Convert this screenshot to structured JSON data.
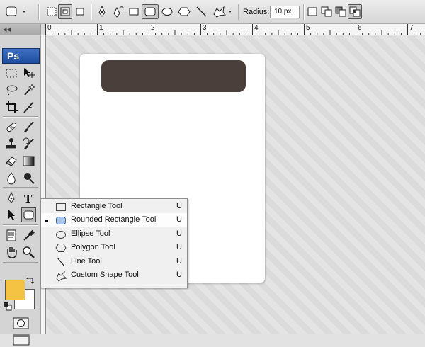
{
  "options_bar": {
    "radius_label": "Radius:",
    "radius_value": "10 px",
    "tool_icons": [
      "rounded-rectangle-preset-icon",
      "shape-layers-mode-icon",
      "paths-mode-icon",
      "fill-pixels-mode-icon",
      "pen-tool-icon",
      "freeform-pen-tool-icon",
      "rectangle-tool-icon",
      "rounded-rectangle-tool-icon",
      "ellipse-tool-icon",
      "polygon-tool-icon",
      "line-tool-icon",
      "custom-shape-tool-icon",
      "combine-shape-icons"
    ]
  },
  "toolbox": {
    "logo": "Ps",
    "grip": "◂◂",
    "foreground_color": "#f5c343",
    "background_color": "#ffffff"
  },
  "ruler": {
    "labels": [
      "0",
      "1",
      "2",
      "3",
      "4",
      "5",
      "6",
      "7"
    ]
  },
  "canvas": {
    "shape_color": "#4a3f3a"
  },
  "flyout": {
    "items": [
      {
        "label": "Rectangle Tool",
        "key": "U",
        "icon": "rectangle-icon",
        "selected": false
      },
      {
        "label": "Rounded Rectangle Tool",
        "key": "U",
        "icon": "rounded-rectangle-icon",
        "selected": true
      },
      {
        "label": "Ellipse Tool",
        "key": "U",
        "icon": "ellipse-icon",
        "selected": false
      },
      {
        "label": "Polygon Tool",
        "key": "U",
        "icon": "polygon-icon",
        "selected": false
      },
      {
        "label": "Line Tool",
        "key": "U",
        "icon": "line-icon",
        "selected": false
      },
      {
        "label": "Custom Shape Tool",
        "key": "U",
        "icon": "custom-shape-icon",
        "selected": false
      }
    ]
  }
}
